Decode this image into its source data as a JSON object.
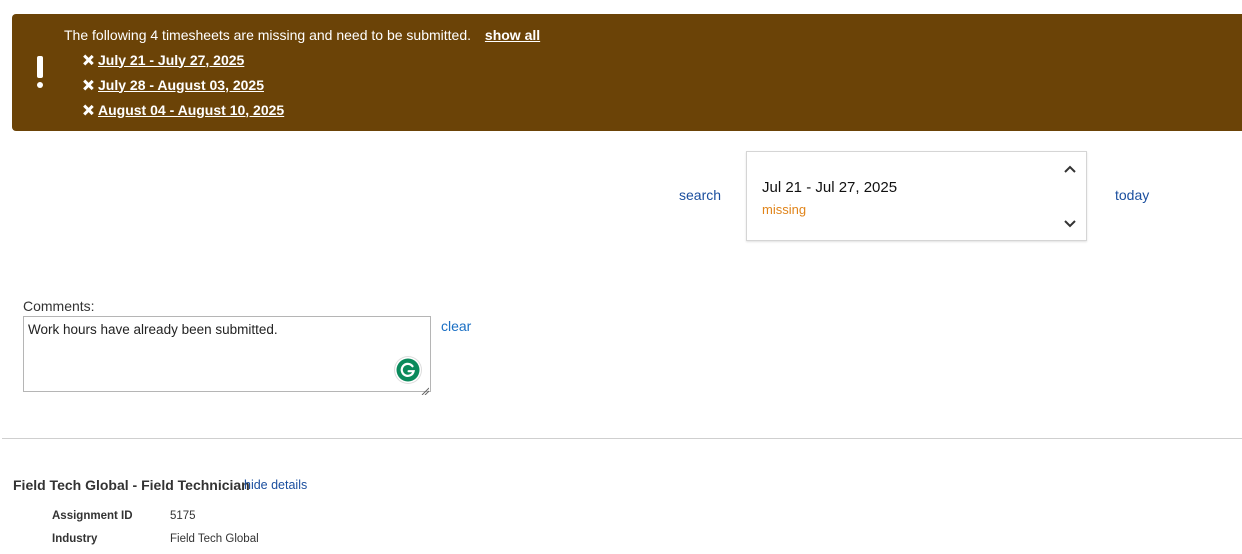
{
  "alert": {
    "message": "The following 4 timesheets are missing and need to be submitted.",
    "show_all_label": "show all",
    "missing_weeks": [
      {
        "label": "July 21 - July 27, 2025"
      },
      {
        "label": "July 28 - August 03, 2025"
      },
      {
        "label": "August 04 - August 10, 2025"
      }
    ]
  },
  "week_nav": {
    "search_label": "search",
    "today_label": "today",
    "selected_range": "Jul 21 - Jul 27, 2025",
    "selected_status": "missing"
  },
  "comments": {
    "label": "Comments:",
    "value": "Work hours have already been submitted.",
    "clear_label": "clear"
  },
  "assignment": {
    "title": "Field Tech Global - Field Technician",
    "hide_details_label": "hide details",
    "details": [
      {
        "key": "Assignment ID",
        "value": "5175"
      },
      {
        "key": "Industry",
        "value": "Field Tech Global"
      }
    ]
  },
  "colors": {
    "alert_bg": "#6b4307",
    "link_blue": "#1a4e9e",
    "status_missing": "#e0841a",
    "grammarly_green": "#15c39a"
  }
}
